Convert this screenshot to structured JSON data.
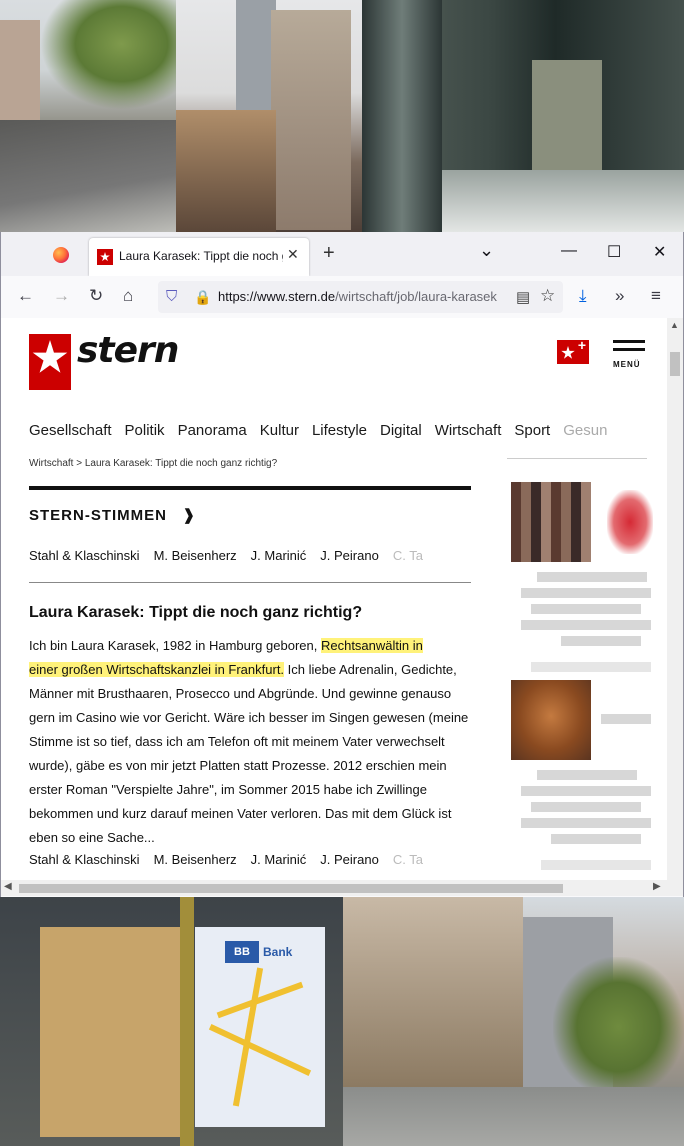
{
  "browser": {
    "tab_title": "Laura Karasek: Tippt die noch ganz richtig?",
    "tab_close": "✕",
    "new_tab": "+",
    "list_tabs": "⌄",
    "minimize": "—",
    "maximize": "☐",
    "close": "✕",
    "url_domain": "https://www.stern.de",
    "url_path": "/wirtschaft/job/laura-karasek",
    "icons": {
      "back": "←",
      "forward": "→",
      "reload": "↻",
      "home": "⌂",
      "shield": "⛉",
      "lock": "🔒",
      "reader": "▤",
      "star": "☆",
      "download": "⤓",
      "overflow": "»",
      "menu": "≡"
    }
  },
  "site": {
    "logo_text": "stern",
    "menu_label": "MENÜ",
    "nav": [
      "Gesellschaft",
      "Politik",
      "Panorama",
      "Kultur",
      "Lifestyle",
      "Digital",
      "Wirtschaft",
      "Sport",
      "Gesun"
    ],
    "breadcrumb": "Wirtschaft > Laura Karasek: Tippt die noch ganz richtig?",
    "section_title": "STERN-STIMMEN",
    "section_arrow": "❱",
    "authors": [
      "Stahl & Klaschinski",
      "M. Beisenherz",
      "J. Marinić",
      "J. Peirano",
      "C. Ta"
    ],
    "article_title": "Laura Karasek: Tippt die noch ganz richtig?",
    "article_body_before": "Ich bin Laura Karasek, 1982 in Hamburg geboren, ",
    "article_highlight_1": "Rechtsanwältin in",
    "article_highlight_2": "einer großen Wirtschaftskanzlei in Frankfurt.",
    "article_body_after": " Ich liebe Adrenalin, Gedichte, Männer mit Brusthaaren, Prosecco und Abgründe. Und gewinne genauso gern im Casino wie vor Gericht. Wäre ich besser im Singen gewesen (meine Stimme ist so tief, dass ich am Telefon oft mit meinem Vater verwechselt wurde), gäbe es von mir jetzt Platten statt Prozesse. 2012 erschien mein erster Roman \"Verspielte Jahre\", im Sommer 2015 habe ich Zwillinge bekommen und kurz darauf meinen Vater verloren. Das mit dem Glück ist eben so eine Sache..."
  },
  "poster": {
    "bank_name": "Bank",
    "bank_logo": "BB"
  }
}
